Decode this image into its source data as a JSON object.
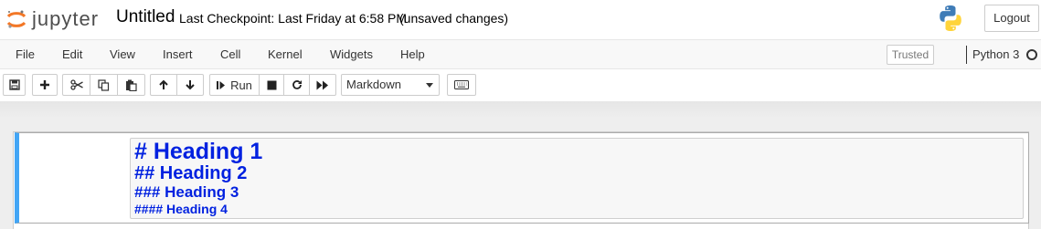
{
  "header": {
    "logo_text": "jupyter",
    "notebook_title": "Untitled",
    "checkpoint": "Last Checkpoint: Last Friday at 6:58 PM",
    "autosave_status": "(unsaved changes)",
    "logout_label": "Logout"
  },
  "menubar": {
    "items": [
      "File",
      "Edit",
      "View",
      "Insert",
      "Cell",
      "Kernel",
      "Widgets",
      "Help"
    ],
    "trusted_label": "Trusted",
    "kernel_name": "Python 3"
  },
  "toolbar": {
    "run_label": "Run",
    "cell_type": "Markdown"
  },
  "cell": {
    "lines": [
      "# Heading 1",
      "## Heading 2",
      "### Heading 3",
      "#### Heading 4"
    ]
  },
  "colors": {
    "accent": "#42a5f5",
    "header_text": "#0021e0",
    "logo_orange": "#f37726"
  }
}
